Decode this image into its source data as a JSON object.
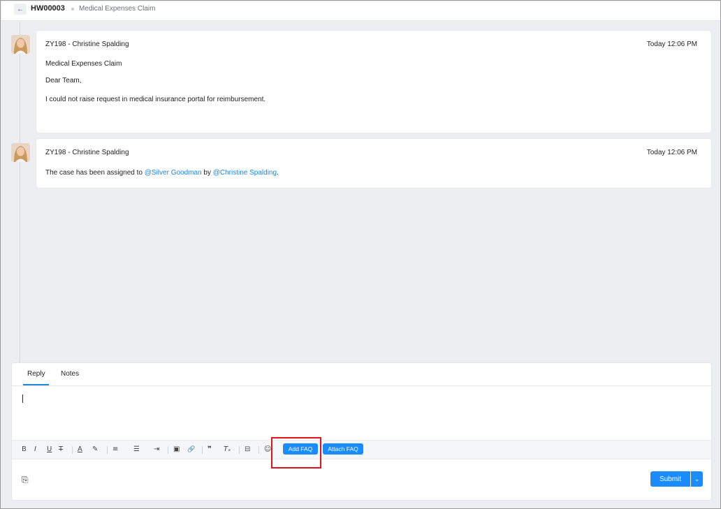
{
  "header": {
    "back_icon": "←",
    "case_id": "HW00003",
    "case_title": "Medical Expenses Claim"
  },
  "messages": [
    {
      "author": "ZY198 - Christine Spalding",
      "time": "Today 12:06 PM",
      "subject": "Medical Expenses Claim",
      "greeting": "Dear Team,",
      "body": "I could not raise request in medical insurance portal for reimbursement."
    },
    {
      "author": "ZY198 - Christine Spalding",
      "time": "Today 12:06 PM",
      "text_before": "The case has been assigned to ",
      "mention1": "@Silver Goodman",
      "text_mid": " by ",
      "mention2": "@Christine Spalding",
      "text_after": "."
    }
  ],
  "composer": {
    "tabs": [
      "Reply",
      "Notes"
    ],
    "active_tab": "Reply",
    "toolbar": {
      "bold": "B",
      "italic": "I",
      "underline": "U",
      "strike": "T",
      "font_color": "A",
      "highlight": "✎",
      "align": "≡",
      "list": "☰",
      "indent": "⇥",
      "image": "▣",
      "link": "🔗",
      "quote": "❞",
      "clear_format": "Tₓ",
      "divider": "⊟",
      "emoji": "☺",
      "add_faq": "Add FAQ",
      "attach_faq": "Attach FAQ"
    },
    "attach_icon": "⎘",
    "submit_label": "Submit",
    "submit_dropdown_icon": "⌄"
  },
  "colors": {
    "accent": "#1a8cff",
    "mention": "#1a86d8",
    "highlight_box": "#e0121b",
    "background": "#eceef2"
  }
}
